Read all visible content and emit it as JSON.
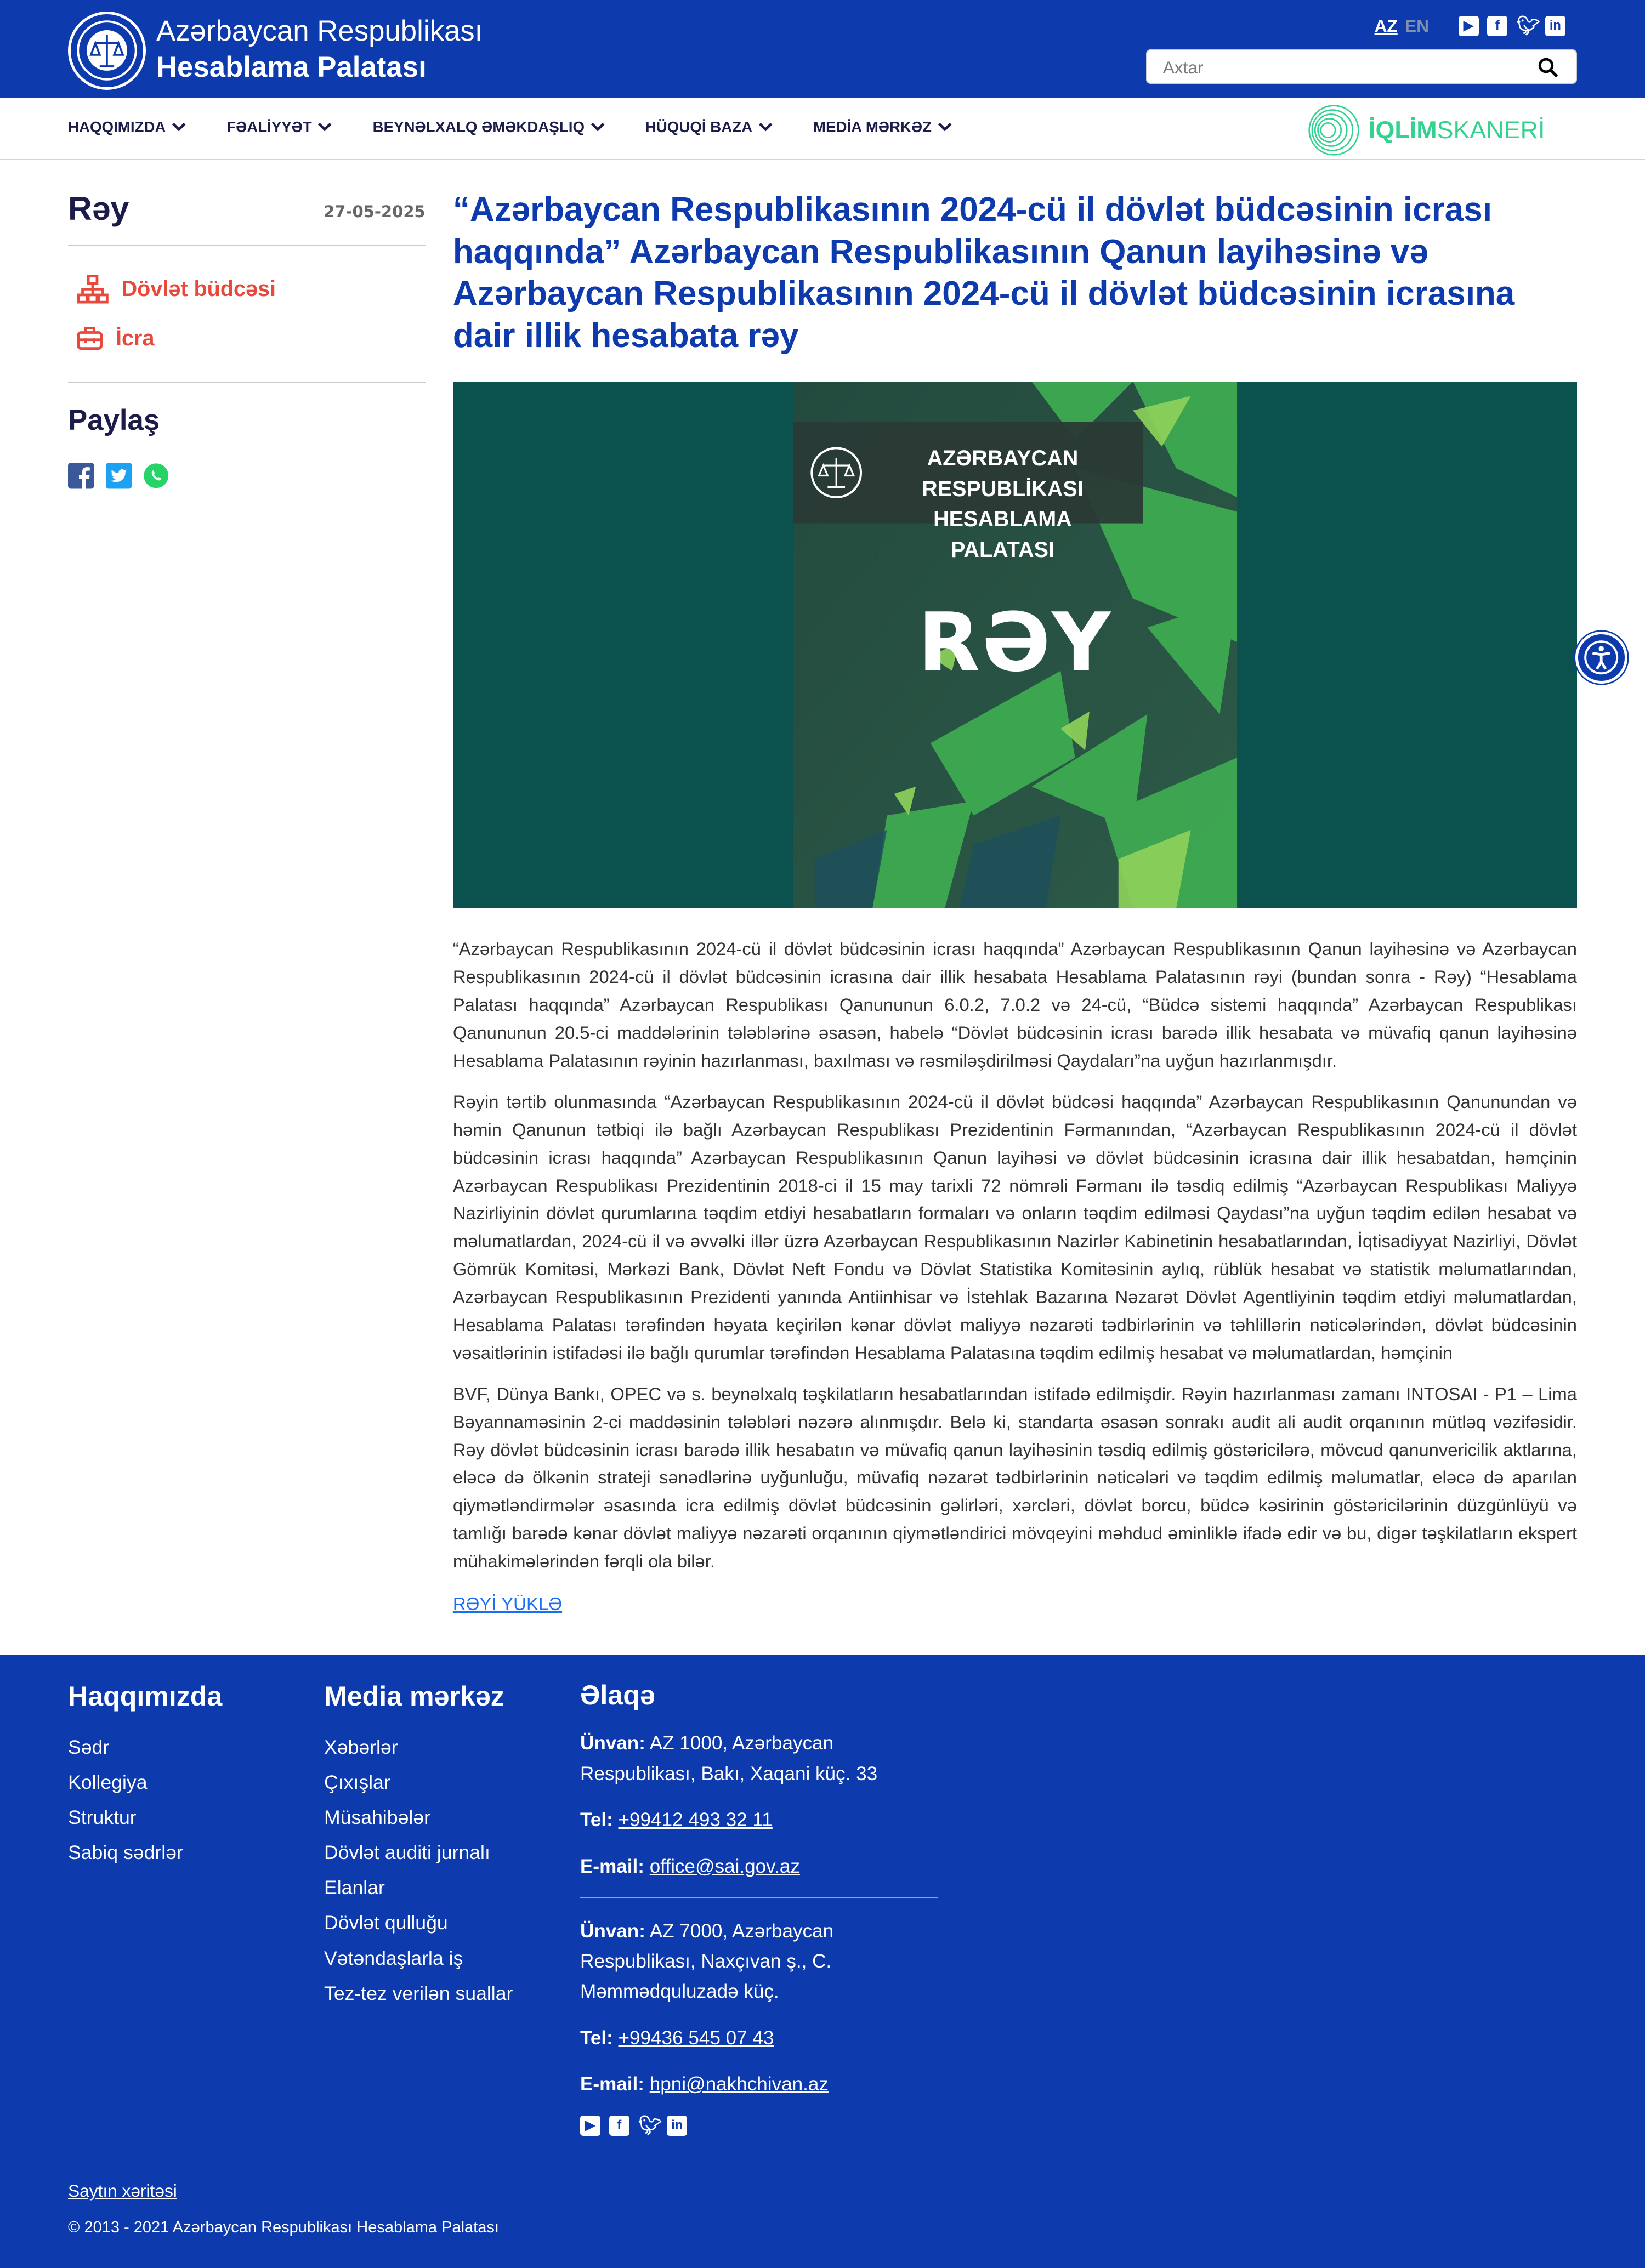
{
  "header": {
    "title_line1": "Azərbaycan Respublikası",
    "title_line2": "Hesablama Palatası",
    "lang_az": "AZ",
    "lang_en": "EN",
    "search_placeholder": "Axtar",
    "social": [
      "youtube-icon",
      "facebook-icon",
      "twitter-icon",
      "linkedin-icon"
    ]
  },
  "nav": {
    "items": [
      {
        "label": "HAQQIMIZDA"
      },
      {
        "label": "FƏALİYYƏT"
      },
      {
        "label": "BEYNƏLXALQ ƏMƏKDAŞLIQ"
      },
      {
        "label": "HÜQUQİ BAZA"
      },
      {
        "label": "MEDİA MƏRKƏZ"
      }
    ],
    "iqlim_bold": "İQLİM",
    "iqlim_rest": "SKANERİ"
  },
  "sidebar": {
    "title": "Rəy",
    "date": "27-05-2025",
    "categories": [
      {
        "label": "Dövlət büdcəsi",
        "icon": "sitemap-icon"
      },
      {
        "label": "İcra",
        "icon": "toolbox-icon"
      }
    ],
    "share_title": "Paylaş"
  },
  "article": {
    "title": "“Azərbaycan Respublikasının 2024-cü il dövlət büdcəsinin icrası haqqında” Azərbaycan Respublikasının Qanun layihəsinə və Azərbaycan Respublikasının 2024-cü il dövlət büdcəsinin icrasına dair illik hesabata rəy",
    "image": {
      "badge_line1": "AZƏRBAYCAN RESPUBLİKASI",
      "badge_line2": "HESABLAMA PALATASI",
      "big_text": "RƏY"
    },
    "paragraphs": [
      "“Azərbaycan Respublikasının 2024-cü il dövlət büdcəsinin icrası haqqında” Azərbaycan Respublikasının Qanun layihəsinə və Azərbaycan Respublikasının 2024-cü il dövlət büdcəsinin icrasına dair illik hesabata Hesablama Palatasının rəyi (bundan sonra - Rəy) “Hesablama Palatası haqqında” Azərbaycan Respublikası Qanununun 6.0.2, 7.0.2 və 24-cü, “Büdcə sistemi haqqında” Azərbaycan Respublikası Qanununun 20.5-ci maddələrinin tələblərinə əsasən, habelə “Dövlət büdcəsinin icrası barədə illik hesabata və müvafiq qanun layihəsinə Hesablama Palatasının rəyinin hazırlanması, baxılması və rəsmiləşdirilməsi Qaydaları”na uyğun hazırlanmışdır.",
      "Rəyin tərtib olunmasında “Azərbaycan Respublikasının 2024-cü il dövlət büdcəsi haqqında” Azərbaycan Respublikasının Qanunundan və həmin Qanunun tətbiqi ilə bağlı Azərbaycan Respublikası Prezidentinin Fərmanından, “Azərbaycan Respublikasının 2024-cü il dövlət büdcəsinin icrası haqqında” Azərbaycan Respublikasının Qanun layihəsi və dövlət büdcəsinin icrasına dair illik hesabatdan, həmçinin Azərbaycan Respublikası Prezidentinin 2018-ci il 15 may tarixli 72 nömrəli Fərmanı ilə təsdiq edilmiş “Azərbaycan Respublikası Maliyyə Nazirliyinin dövlət qurumlarına təqdim etdiyi hesabatların formaları və onların təqdim edilməsi Qaydası”na uyğun təqdim edilən hesabat və məlumatlardan, 2024-cü il və əvvəlki illər üzrə Azərbaycan Respublikasının Nazirlər Kabinetinin hesabatlarından, İqtisadiyyat Nazirliyi, Dövlət Gömrük Komitəsi, Mərkəzi Bank, Dövlət Neft Fondu və Dövlət Statistika Komitəsinin aylıq, rüblük hesabat və statistik məlumatlarından, Azərbaycan Respublikasının Prezidenti yanında Antiinhisar və İstehlak Bazarına Nəzarət Dövlət Agentliyinin təqdim etdiyi məlumatlardan, Hesablama Palatası tərəfindən həyata keçirilən kənar dövlət maliyyə nəzarəti tədbirlərinin və təhlillərin nəticələrindən, dövlət büdcəsinin vəsaitlərinin istifadəsi ilə bağlı qurumlar tərəfindən Hesablama Palatasına təqdim edilmiş hesabat və məlumatlardan, həmçinin",
      "BVF, Dünya Bankı, OPEC və s. beynəlxalq təşkilatların hesabatlarından istifadə edilmişdir. Rəyin hazırlanması zamanı INTOSAI - P1 – Lima Bəyannaməsinin 2-ci maddəsinin tələbləri nəzərə alınmışdır. Belə ki, standarta əsasən sonrakı audit ali audit orqanının mütləq vəzifəsidir. Rəy dövlət büdcəsinin icrası barədə illik hesabatın və müvafiq qanun layihəsinin təsdiq edilmiş göstəricilərə, mövcud qanunvericilik aktlarına, eləcə də ölkənin strateji sənədlərinə uyğunluğu, müvafiq nəzarət tədbirlərinin nəticələri və təqdim edilmiş məlumatlar, eləcə də aparılan qiymətləndirmələr əsasında icra edilmiş dövlət büdcəsinin gəlirləri, xərcləri, dövlət borcu, büdcə kəsirinin göstəricilərinin düzgünlüyü və tamlığı barədə kənar dövlət maliyyə nəzarəti orqanının qiymətləndirici mövqeyini məhdud əminliklə ifadə edir və bu, digər təşkilatların ekspert mühakimələrindən fərqli ola bilər."
    ],
    "download_label": "RƏYİ YÜKLƏ"
  },
  "footer": {
    "col1": {
      "title": "Haqqımızda",
      "items": [
        "Sədr",
        "Kollegiya",
        "Struktur",
        "Sabiq sədrlər"
      ]
    },
    "col2": {
      "title": "Media mərkəz",
      "items": [
        "Xəbərlər",
        "Çıxışlar",
        "Müsahibələr",
        "Dövlət auditi jurnalı",
        "Elanlar",
        "Dövlət qulluğu",
        "Vətəndaşlarla iş",
        "Tez-tez verilən suallar"
      ]
    },
    "contact": {
      "title": "Əlaqə",
      "address_label": "Ünvan:",
      "tel_label": "Tel:",
      "email_label": "E-mail:",
      "office1": {
        "address": "AZ 1000, Azərbaycan Respublikası, Bakı, Xaqani küç. 33",
        "tel": "+99412 493 32 11",
        "email": "office@sai.gov.az"
      },
      "office2": {
        "address": "AZ 7000, Azərbaycan Respublikası, Naxçıvan ş., C. Məmmədquluzadə küç.",
        "tel": "+99436 545 07 43",
        "email": "hpni@nakhchivan.az"
      }
    },
    "sitemap": "Saytın xəritəsi",
    "copyright": "© 2013 - 2021 Azərbaycan Respublikası Hesablama Palatası"
  },
  "colors": {
    "brand_blue": "#0d3aac",
    "accent_red": "#e8493c",
    "link_blue": "#1a6ef5",
    "iqlim_green": "#33d38f"
  }
}
